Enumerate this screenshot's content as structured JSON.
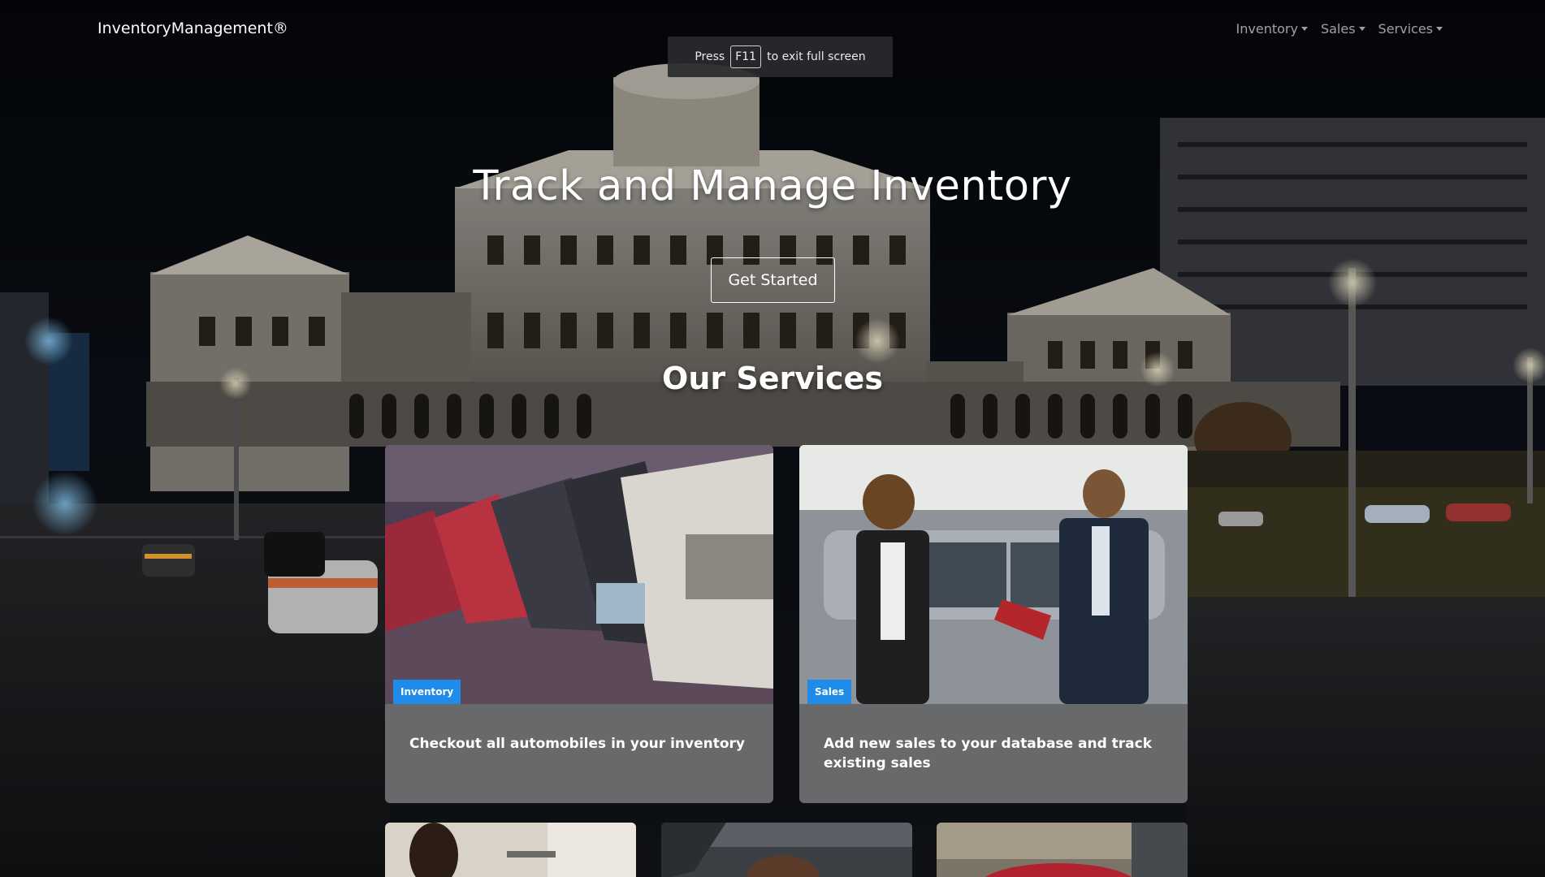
{
  "navbar": {
    "brand": "InventoryManagement®",
    "links": [
      {
        "label": "Inventory"
      },
      {
        "label": "Sales"
      },
      {
        "label": "Services"
      }
    ]
  },
  "fullscreen_toast": {
    "before": "Press",
    "key": "F11",
    "after": "to exit full screen"
  },
  "hero": {
    "title": "Track and Manage Inventory",
    "button": "Get Started"
  },
  "services": {
    "title": "Our Services",
    "cards": [
      {
        "badge": "Inventory",
        "text": "Checkout all automobiles in your inventory",
        "image": "cars-in-row-image"
      },
      {
        "badge": "Sales",
        "text": "Add new sales to your database and track existing sales",
        "image": "salesperson-client-image"
      }
    ],
    "more_cards": [
      {
        "image": "office-person-image"
      },
      {
        "image": "mechanic-image"
      },
      {
        "image": "red-car-image"
      }
    ]
  },
  "colors": {
    "badge": "#1f8cea",
    "card_bg": "#78787a",
    "nav_link": "#a3a3a3"
  }
}
